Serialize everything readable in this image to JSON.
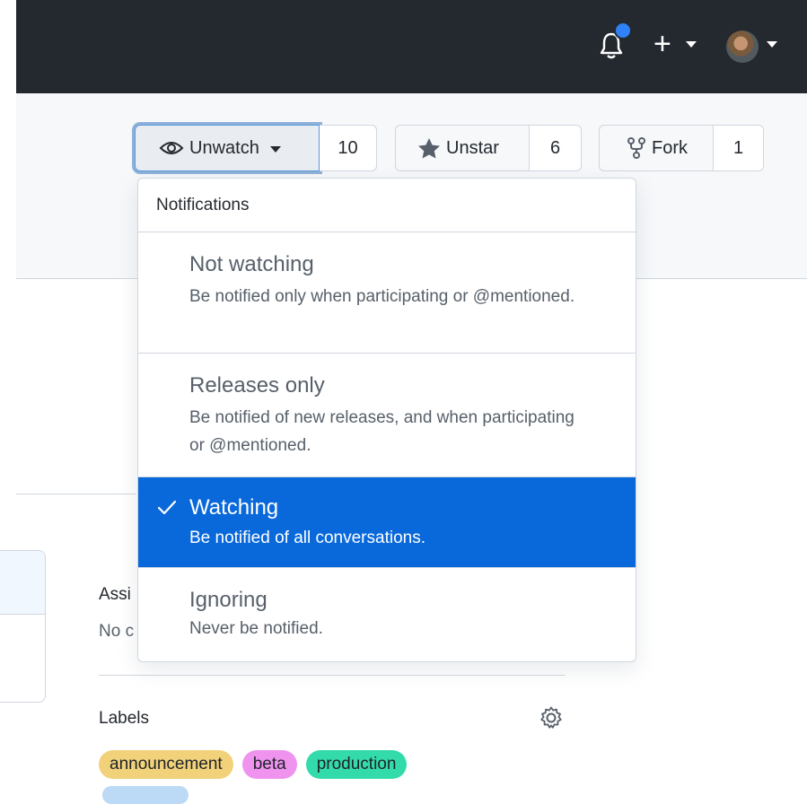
{
  "header": {
    "notifications_icon": "bell-icon",
    "create_icon": "plus-icon",
    "avatar_icon": "avatar-icon"
  },
  "repo_actions": {
    "watch": {
      "label": "Unwatch",
      "count": "10",
      "icon": "eye-icon"
    },
    "star": {
      "label": "Unstar",
      "count": "6",
      "icon": "star-icon"
    },
    "fork": {
      "label": "Fork",
      "count": "1",
      "icon": "fork-icon"
    }
  },
  "notifications_menu": {
    "header": "Notifications",
    "items": [
      {
        "title": "Not watching",
        "description": "Be notified only when participating or @mentioned.",
        "selected": false
      },
      {
        "title": "Releases only",
        "description": "Be notified of new releases, and when participating or @mentioned.",
        "selected": false
      },
      {
        "title": "Watching",
        "description": "Be notified of all conversations.",
        "selected": true
      },
      {
        "title": "Ignoring",
        "description": "Never be notified.",
        "selected": false
      }
    ]
  },
  "sidebar": {
    "assignees_heading": "Assi",
    "assignees_value": "No c",
    "labels_heading": "Labels",
    "labels": [
      {
        "name": "announcement",
        "color": "#f1d17a"
      },
      {
        "name": "beta",
        "color": "#ef93ef"
      },
      {
        "name": "production",
        "color": "#33dbaa"
      }
    ]
  },
  "colors": {
    "accent": "#0969da",
    "header_bg": "#24292f",
    "notification_dot": "#2f81f7"
  }
}
